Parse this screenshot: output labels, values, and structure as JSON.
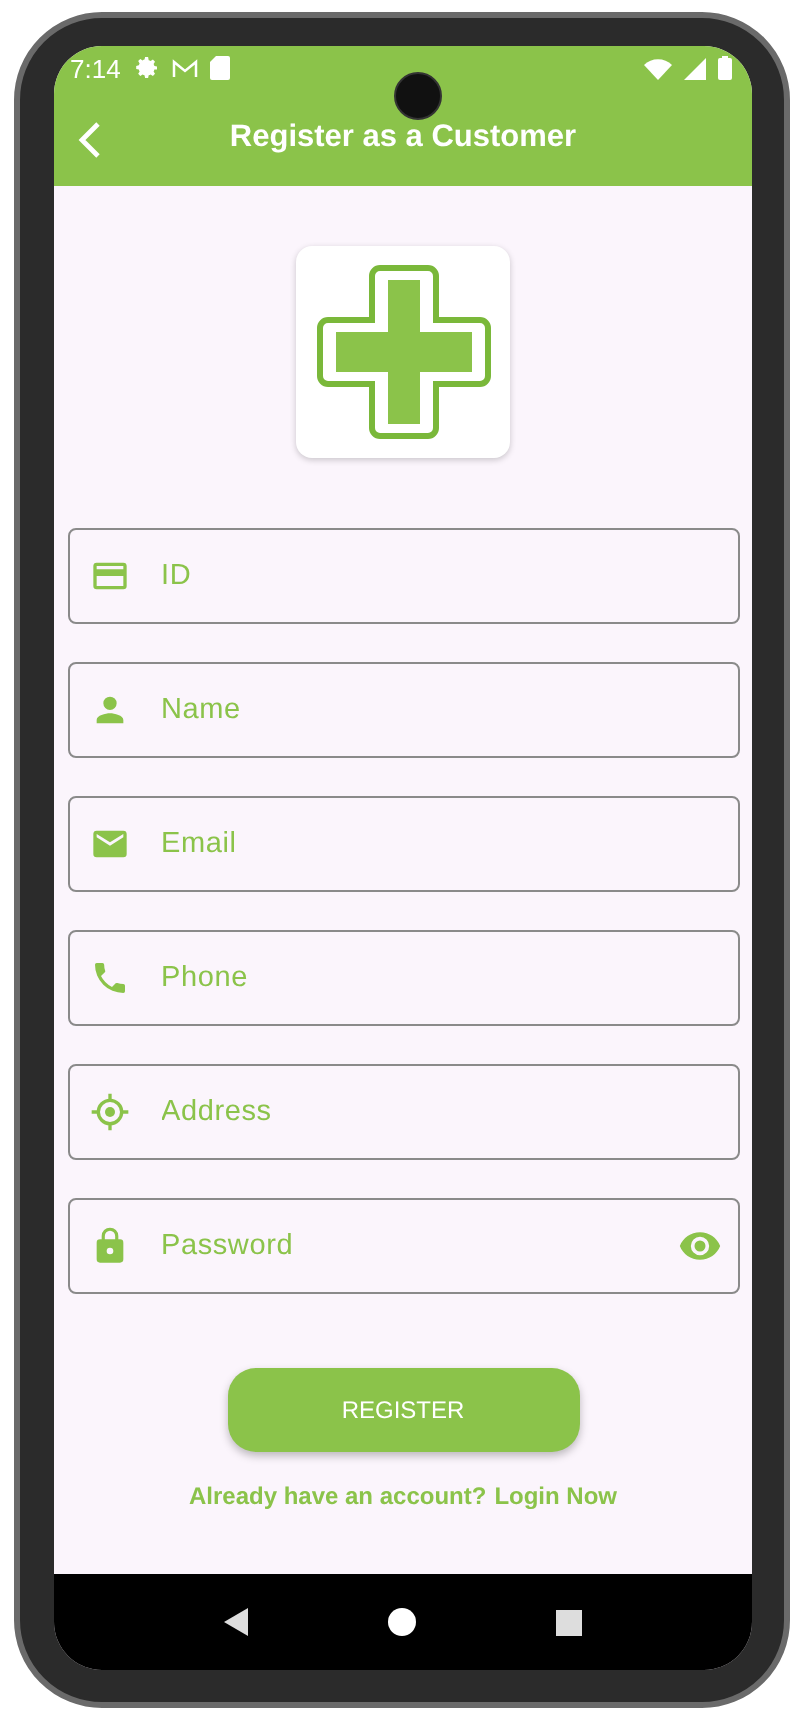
{
  "status_bar": {
    "time": "7:14"
  },
  "app_bar": {
    "title": "Register as a Customer"
  },
  "fields": [
    {
      "kind": "id",
      "placeholder": "ID"
    },
    {
      "kind": "name",
      "placeholder": "Name"
    },
    {
      "kind": "email",
      "placeholder": "Email"
    },
    {
      "kind": "phone",
      "placeholder": "Phone"
    },
    {
      "kind": "address",
      "placeholder": "Address"
    },
    {
      "kind": "password",
      "placeholder": "Password"
    }
  ],
  "register_button": "REGISTER",
  "login_prompt": {
    "text": "Already have an account?",
    "link": "Login Now"
  }
}
